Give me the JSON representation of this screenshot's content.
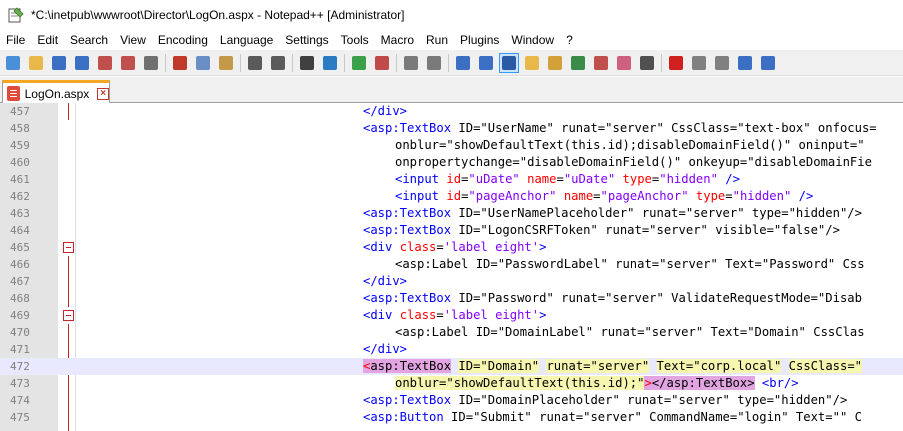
{
  "window": {
    "title": "*C:\\inetpub\\wwwroot\\Director\\LogOn.aspx - Notepad++ [Administrator]"
  },
  "menu": [
    "File",
    "Edit",
    "Search",
    "View",
    "Encoding",
    "Language",
    "Settings",
    "Tools",
    "Macro",
    "Run",
    "Plugins",
    "Window",
    "?"
  ],
  "toolbar": {
    "buttons": [
      {
        "icon": "new-file-icon",
        "color": "#4a90d9"
      },
      {
        "icon": "open-file-icon",
        "color": "#e8b84a"
      },
      {
        "icon": "save-icon",
        "color": "#3a6fc4"
      },
      {
        "icon": "save-all-icon",
        "color": "#3a6fc4"
      },
      {
        "icon": "close-file-icon",
        "color": "#c0504d"
      },
      {
        "icon": "close-all-icon",
        "color": "#c0504d"
      },
      {
        "icon": "print-icon",
        "color": "#707070"
      },
      {
        "sep": true
      },
      {
        "icon": "cut-icon",
        "color": "#c0392b"
      },
      {
        "icon": "copy-icon",
        "color": "#6a8fc4"
      },
      {
        "icon": "paste-icon",
        "color": "#c49a4a"
      },
      {
        "sep": true
      },
      {
        "icon": "undo-icon",
        "color": "#5a5a5a"
      },
      {
        "icon": "redo-icon",
        "color": "#5a5a5a"
      },
      {
        "sep": true
      },
      {
        "icon": "find-icon",
        "color": "#404040"
      },
      {
        "icon": "replace-icon",
        "color": "#2a7ac4"
      },
      {
        "sep": true
      },
      {
        "icon": "zoom-in-icon",
        "color": "#3aa14a"
      },
      {
        "icon": "zoom-out-icon",
        "color": "#c04a4a"
      },
      {
        "sep": true
      },
      {
        "icon": "sync-vertical-icon",
        "color": "#7a7a7a"
      },
      {
        "icon": "sync-horizontal-icon",
        "color": "#7a7a7a"
      },
      {
        "sep": true
      },
      {
        "icon": "word-wrap-icon",
        "color": "#3a6fc4"
      },
      {
        "icon": "show-all-characters-icon",
        "color": "#3a6fc4"
      },
      {
        "icon": "indent-guide-icon",
        "color": "#2a5aa4",
        "active": true
      },
      {
        "icon": "user-language-icon",
        "color": "#e8b84a"
      },
      {
        "icon": "document-map-icon",
        "color": "#d4a03a"
      },
      {
        "icon": "function-list-icon",
        "color": "#3a8a4a"
      },
      {
        "icon": "folder-workspace-icon",
        "color": "#c0504d"
      },
      {
        "icon": "monitoring-icon",
        "color": "#d06080"
      },
      {
        "icon": "eye-icon",
        "color": "#505050"
      },
      {
        "sep": true
      },
      {
        "icon": "record-macro-icon",
        "color": "#d02020"
      },
      {
        "icon": "stop-macro-icon",
        "color": "#808080"
      },
      {
        "icon": "play-macro-icon",
        "color": "#808080"
      },
      {
        "icon": "run-multiple-macro-icon",
        "color": "#3a6fc4"
      },
      {
        "icon": "save-macro-icon",
        "color": "#3a6fc4"
      }
    ]
  },
  "tab": {
    "label": "LogOn.aspx"
  },
  "editor": {
    "lines": [
      {
        "n": "457",
        "indent": 0,
        "tokens": [
          [
            "tag",
            "</div>"
          ]
        ]
      },
      {
        "n": "458",
        "indent": 0,
        "tokens": [
          [
            "tag",
            "<asp:TextBox"
          ],
          [
            "plain",
            " ID=\"UserName\" runat=\"server\" CssClass=\"text-box\" onfocus="
          ]
        ]
      },
      {
        "n": "459",
        "indent": 1,
        "tokens": [
          [
            "plain",
            "onblur=\"showDefaultText(this.id);disableDomainField()\" oninput=\""
          ]
        ]
      },
      {
        "n": "460",
        "indent": 1,
        "tokens": [
          [
            "plain",
            "onpropertychange=\"disableDomainField()\" onkeyup=\"disableDomainFie"
          ]
        ]
      },
      {
        "n": "461",
        "indent": 1,
        "tokens": [
          [
            "tag",
            "<input "
          ],
          [
            "attr",
            "id"
          ],
          [
            "plain",
            "="
          ],
          [
            "val",
            "\"uDate\""
          ],
          [
            "plain",
            " "
          ],
          [
            "attr",
            "name"
          ],
          [
            "plain",
            "="
          ],
          [
            "val",
            "\"uDate\""
          ],
          [
            "plain",
            " "
          ],
          [
            "attr",
            "type"
          ],
          [
            "plain",
            "="
          ],
          [
            "val",
            "\"hidden\""
          ],
          [
            "plain",
            " "
          ],
          [
            "tag",
            "/>"
          ]
        ]
      },
      {
        "n": "462",
        "indent": 1,
        "tokens": [
          [
            "tag",
            "<input "
          ],
          [
            "attr",
            "id"
          ],
          [
            "plain",
            "="
          ],
          [
            "val",
            "\"pageAnchor\""
          ],
          [
            "plain",
            " "
          ],
          [
            "attr",
            "name"
          ],
          [
            "plain",
            "="
          ],
          [
            "val",
            "\"pageAnchor\""
          ],
          [
            "plain",
            " "
          ],
          [
            "attr",
            "type"
          ],
          [
            "plain",
            "="
          ],
          [
            "val",
            "\"hidden\""
          ],
          [
            "plain",
            " "
          ],
          [
            "tag",
            "/>"
          ]
        ]
      },
      {
        "n": "463",
        "indent": 0,
        "tokens": [
          [
            "tag",
            "<asp:TextBox"
          ],
          [
            "plain",
            " ID=\"UserNamePlaceholder\" runat=\"server\" type=\"hidden\"/>"
          ]
        ]
      },
      {
        "n": "464",
        "indent": 0,
        "tokens": [
          [
            "tag",
            "<asp:TextBox"
          ],
          [
            "plain",
            " ID=\"LogonCSRFToken\" runat=\"server\" visible=\"false\"/>"
          ]
        ]
      },
      {
        "n": "465",
        "indent": 0,
        "fold": true,
        "tokens": [
          [
            "tag",
            "<div "
          ],
          [
            "attr",
            "class"
          ],
          [
            "plain",
            "="
          ],
          [
            "val",
            "'label eight'"
          ],
          [
            "tag",
            ">"
          ]
        ]
      },
      {
        "n": "466",
        "indent": 1,
        "tokens": [
          [
            "plain",
            "<asp:Label ID=\"PasswordLabel\" runat=\"server\" Text=\"Password\" Css"
          ]
        ]
      },
      {
        "n": "467",
        "indent": 0,
        "tokens": [
          [
            "tag",
            "</div>"
          ]
        ]
      },
      {
        "n": "468",
        "indent": 0,
        "tokens": [
          [
            "tag",
            "<asp:TextBox"
          ],
          [
            "plain",
            " ID=\"Password\" runat=\"server\" ValidateRequestMode=\"Disab"
          ]
        ]
      },
      {
        "n": "469",
        "indent": 0,
        "fold": true,
        "tokens": [
          [
            "tag",
            "<div "
          ],
          [
            "attr",
            "class"
          ],
          [
            "plain",
            "="
          ],
          [
            "val",
            "'label eight'"
          ],
          [
            "tag",
            ">"
          ]
        ]
      },
      {
        "n": "470",
        "indent": 1,
        "tokens": [
          [
            "plain",
            "<asp:Label ID=\"DomainLabel\" runat=\"server\" Text=\"Domain\" CssClas"
          ]
        ]
      },
      {
        "n": "471",
        "indent": 0,
        "tokens": [
          [
            "tag",
            "</div>"
          ]
        ]
      },
      {
        "n": "472",
        "indent": 0,
        "current": true,
        "tokens": [
          [
            "hl-lt",
            "<"
          ],
          [
            "hl-tag",
            "asp:TextBox"
          ],
          [
            "plain",
            " "
          ],
          [
            "hl-word",
            "ID=\"Domain\""
          ],
          [
            "plain",
            " "
          ],
          [
            "hl-word",
            "runat=\"server\""
          ],
          [
            "plain",
            " "
          ],
          [
            "hl-word",
            "Text=\"corp.local\""
          ],
          [
            "plain",
            " "
          ],
          [
            "hl-word",
            "CssClass=\""
          ]
        ]
      },
      {
        "n": "473",
        "indent": 1,
        "tokens": [
          [
            "hl-word",
            "onblur=\"showDefaultText(this.id);\""
          ],
          [
            "hl-lt",
            ">"
          ],
          [
            "hl-tag",
            "</asp:TextBox>"
          ],
          [
            "plain",
            " "
          ],
          [
            "tag",
            "<br/>"
          ]
        ]
      },
      {
        "n": "474",
        "indent": 0,
        "tokens": [
          [
            "tag",
            "<asp:TextBox"
          ],
          [
            "plain",
            " ID=\"DomainPlaceholder\" runat=\"server\" type=\"hidden\"/>"
          ]
        ]
      },
      {
        "n": "475",
        "indent": 0,
        "tokens": [
          [
            "tag",
            "<asp:Button"
          ],
          [
            "plain",
            " ID=\"Submit\" runat=\"server\" CommandName=\"login\" Text=\"\" C"
          ]
        ]
      }
    ]
  }
}
